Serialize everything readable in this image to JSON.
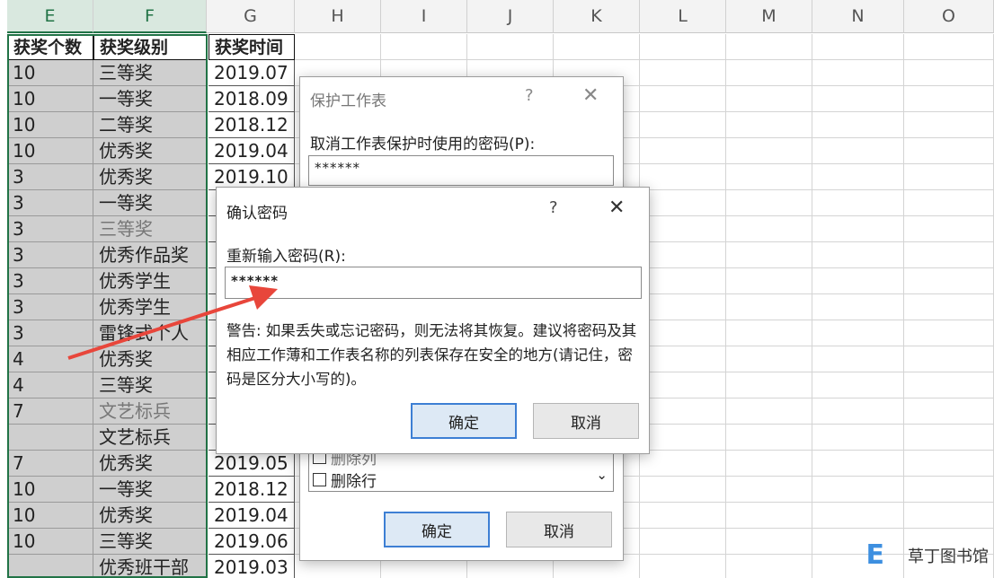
{
  "columns": [
    "E",
    "F",
    "G",
    "H",
    "I",
    "J",
    "K",
    "L",
    "M",
    "N",
    "O"
  ],
  "table": {
    "headers": [
      "获奖个数",
      "获奖级别",
      "获奖时间"
    ],
    "rows": [
      [
        "10",
        "三等奖",
        "2019.07"
      ],
      [
        "10",
        "一等奖",
        "2018.09"
      ],
      [
        "10",
        "二等奖",
        "2018.12"
      ],
      [
        "10",
        "优秀奖",
        "2019.04"
      ],
      [
        "3",
        "优秀奖",
        "2019.10"
      ],
      [
        "3",
        "一等奖",
        ""
      ],
      [
        "3",
        "三等奖",
        ""
      ],
      [
        "3",
        "优秀作品奖",
        ""
      ],
      [
        "3",
        "优秀学生",
        ""
      ],
      [
        "3",
        "优秀学生",
        ""
      ],
      [
        "3",
        "雷锋式个人",
        ""
      ],
      [
        "4",
        "优秀奖",
        ""
      ],
      [
        "4",
        "三等奖",
        ""
      ],
      [
        "7",
        "文艺标兵",
        ""
      ],
      [
        "",
        "文艺标兵",
        ""
      ],
      [
        "7",
        "优秀奖",
        "2019.05"
      ],
      [
        "10",
        "一等奖",
        "2018.12"
      ],
      [
        "10",
        "优秀奖",
        "2019.04"
      ],
      [
        "10",
        "三等奖",
        "2019.06"
      ],
      [
        "",
        "优秀班干部",
        "2019.03"
      ]
    ]
  },
  "protect_dialog": {
    "title": "保护工作表",
    "help": "?",
    "close": "✕",
    "password_label": "取消工作表保护时使用的密码(P):",
    "password_value": "******",
    "options": [
      "删除列",
      "删除行"
    ],
    "ok": "确定",
    "cancel": "取消"
  },
  "confirm_dialog": {
    "title": "确认密码",
    "help": "?",
    "close": "✕",
    "reenter_label": "重新输入密码(R):",
    "password_value": "******",
    "warning": "警告: 如果丢失或忘记密码，则无法将其恢复。建议将密码及其相应工作薄和工作表名称的列表保存在安全的地方(请记住，密码是区分大小写的)。",
    "ok": "确定",
    "cancel": "取消"
  },
  "watermark": {
    "logo": "E",
    "text": "草丁图书馆"
  },
  "colors": {
    "excel_green": "#217346",
    "arrow_red": "#e8463b",
    "ok_border": "#3d7fd4"
  }
}
